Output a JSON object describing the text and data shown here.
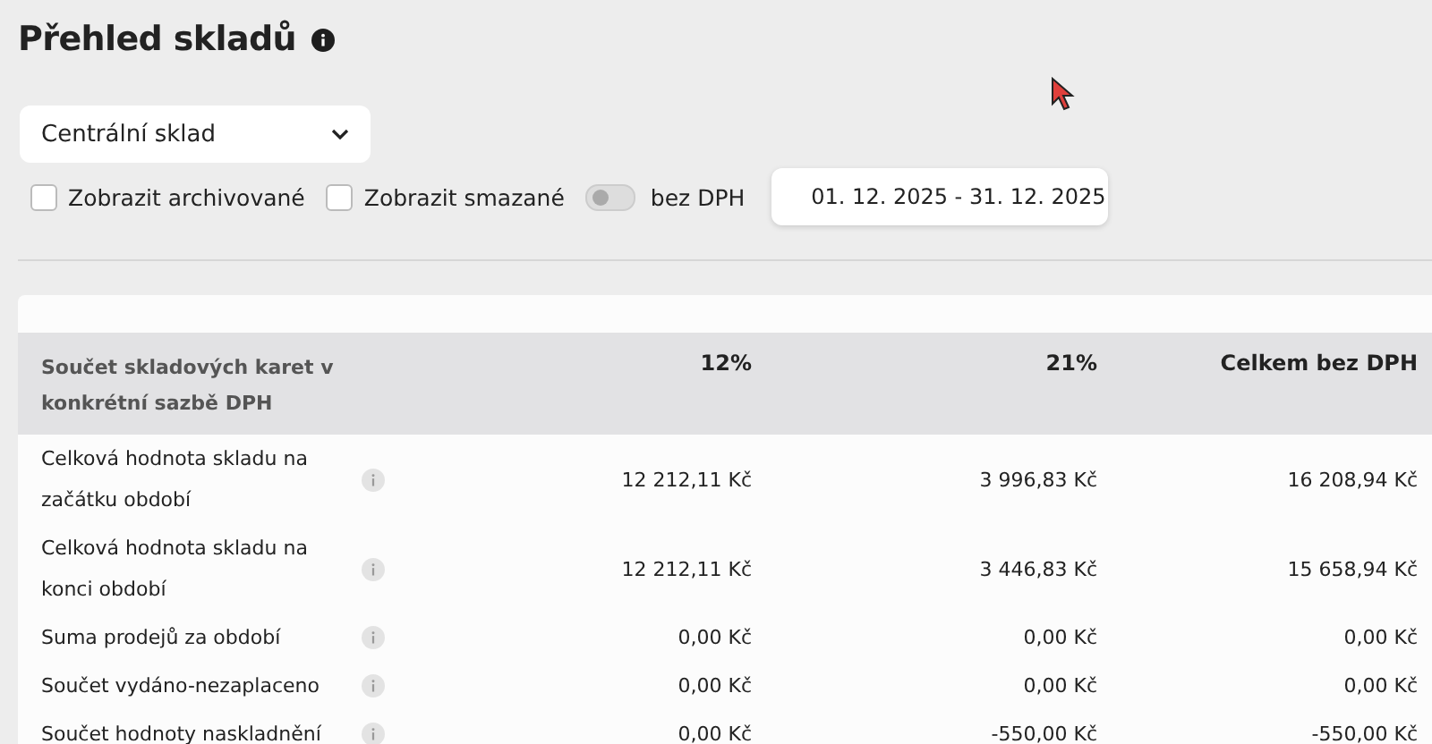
{
  "title": "Přehled skladů",
  "warehouse_select": {
    "value": "Centrální sklad"
  },
  "filters": [
    {
      "kind": "checkbox",
      "label": "Zobrazit archivované",
      "checked": false
    },
    {
      "kind": "checkbox",
      "label": "Zobrazit smazané",
      "checked": false
    },
    {
      "kind": "toggle",
      "label": "bez DPH",
      "on": false
    }
  ],
  "date_range": {
    "value": "01. 12. 2025 - 31. 12. 2025"
  },
  "table": {
    "columns": [
      "Součet skladových karet v konkrétní sazbě DPH",
      "12%",
      "21%",
      "Celkem bez DPH"
    ],
    "rows": [
      {
        "cells": [
          "Celková hodnota skladu na začátku období",
          "12 212,11 Kč",
          "3 996,83 Kč",
          "16 208,94 Kč"
        ]
      },
      {
        "cells": [
          "Celková hodnota skladu na konci období",
          "12 212,11 Kč",
          "3 446,83 Kč",
          "15 658,94 Kč"
        ]
      },
      {
        "cells": [
          "Suma prodejů za období",
          "0,00 Kč",
          "0,00 Kč",
          "0,00 Kč"
        ]
      },
      {
        "cells": [
          "Součet vydáno-nezaplaceno",
          "0,00 Kč",
          "0,00 Kč",
          "0,00 Kč"
        ]
      },
      {
        "cells": [
          "Součet hodnoty naskladnění",
          "0,00 Kč",
          "-550,00 Kč",
          "-550,00 Kč"
        ]
      }
    ]
  }
}
